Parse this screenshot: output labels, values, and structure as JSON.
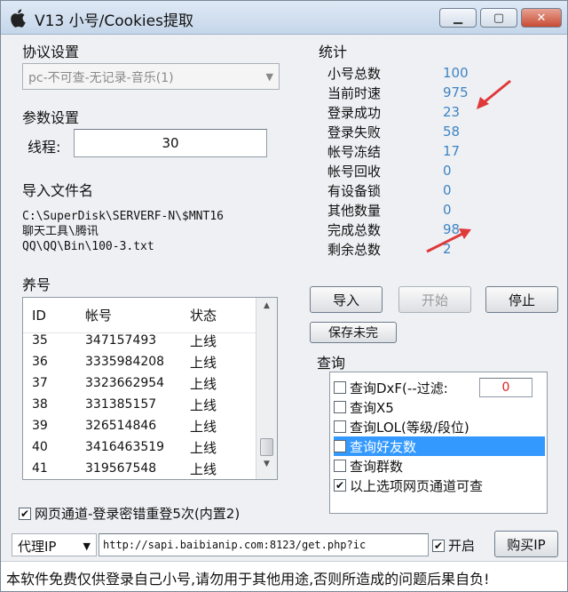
{
  "window": {
    "title": "V13 小号/Cookies提取"
  },
  "protocol": {
    "label": "协议设置",
    "selected": "pc-不可查-无记录-音乐(1)"
  },
  "params": {
    "label": "参数设置",
    "threads_label": "线程:",
    "threads_value": "30"
  },
  "import": {
    "label": "导入文件名",
    "path_lines": [
      "C:\\SuperDisk\\SERVERF-N\\$MNT16",
      "聊天工具\\腾讯",
      "QQ\\QQ\\Bin\\100-3.txt"
    ]
  },
  "stats": {
    "label": "统计",
    "rows": [
      {
        "key": "小号总数",
        "value": "100"
      },
      {
        "key": "当前时速",
        "value": "975"
      },
      {
        "key": "登录成功",
        "value": "23"
      },
      {
        "key": "登录失败",
        "value": "58"
      },
      {
        "key": "帐号冻结",
        "value": "17"
      },
      {
        "key": "帐号回收",
        "value": "0"
      },
      {
        "key": "有设备锁",
        "value": "0"
      },
      {
        "key": "其他数量",
        "value": "0"
      },
      {
        "key": "完成总数",
        "value": "98"
      },
      {
        "key": "剩余总数",
        "value": "2"
      }
    ]
  },
  "buttons": {
    "import": "导入",
    "start": "开始",
    "stop": "停止",
    "save_unfinished": "保存未完",
    "buy_ip": "购买IP"
  },
  "nurture": {
    "label": "养号",
    "columns": [
      "ID",
      "帐号",
      "状态"
    ],
    "rows": [
      [
        "35",
        "347157493",
        "上线"
      ],
      [
        "36",
        "3335984208",
        "上线"
      ],
      [
        "37",
        "3323662954",
        "上线"
      ],
      [
        "38",
        "331385157",
        "上线"
      ],
      [
        "39",
        "326514846",
        "上线"
      ],
      [
        "40",
        "3416463519",
        "上线"
      ],
      [
        "41",
        "319567548",
        "上线"
      ]
    ]
  },
  "query": {
    "label": "查询",
    "filter_value": "0",
    "items": [
      {
        "text": "查询DxF(--过滤:",
        "checked": false
      },
      {
        "text": "查询X5",
        "checked": false
      },
      {
        "text": "查询LOL(等级/段位)",
        "checked": false
      },
      {
        "text": "查询好友数",
        "checked": false
      },
      {
        "text": "查询群数",
        "checked": false
      },
      {
        "text": "以上选项网页通道可查",
        "checked": true
      }
    ]
  },
  "web_channel": {
    "text": "网页通道-登录密错重登5次(内置2)",
    "checked": true
  },
  "proxy": {
    "selected": "代理IP",
    "url": "http://sapi.baibianip.com:8123/get.php?ic",
    "enable_label": "开启",
    "enabled": true
  },
  "footer": {
    "disclaimer": "本软件免费仅供登录自己小号,请勿用于其他用途,否则所造成的问题后果自负!"
  },
  "colors": {
    "stat_value": "#3f84c4",
    "selection": "#3399ff",
    "arrow": "#e0393a",
    "close_button": "#c74c34"
  }
}
